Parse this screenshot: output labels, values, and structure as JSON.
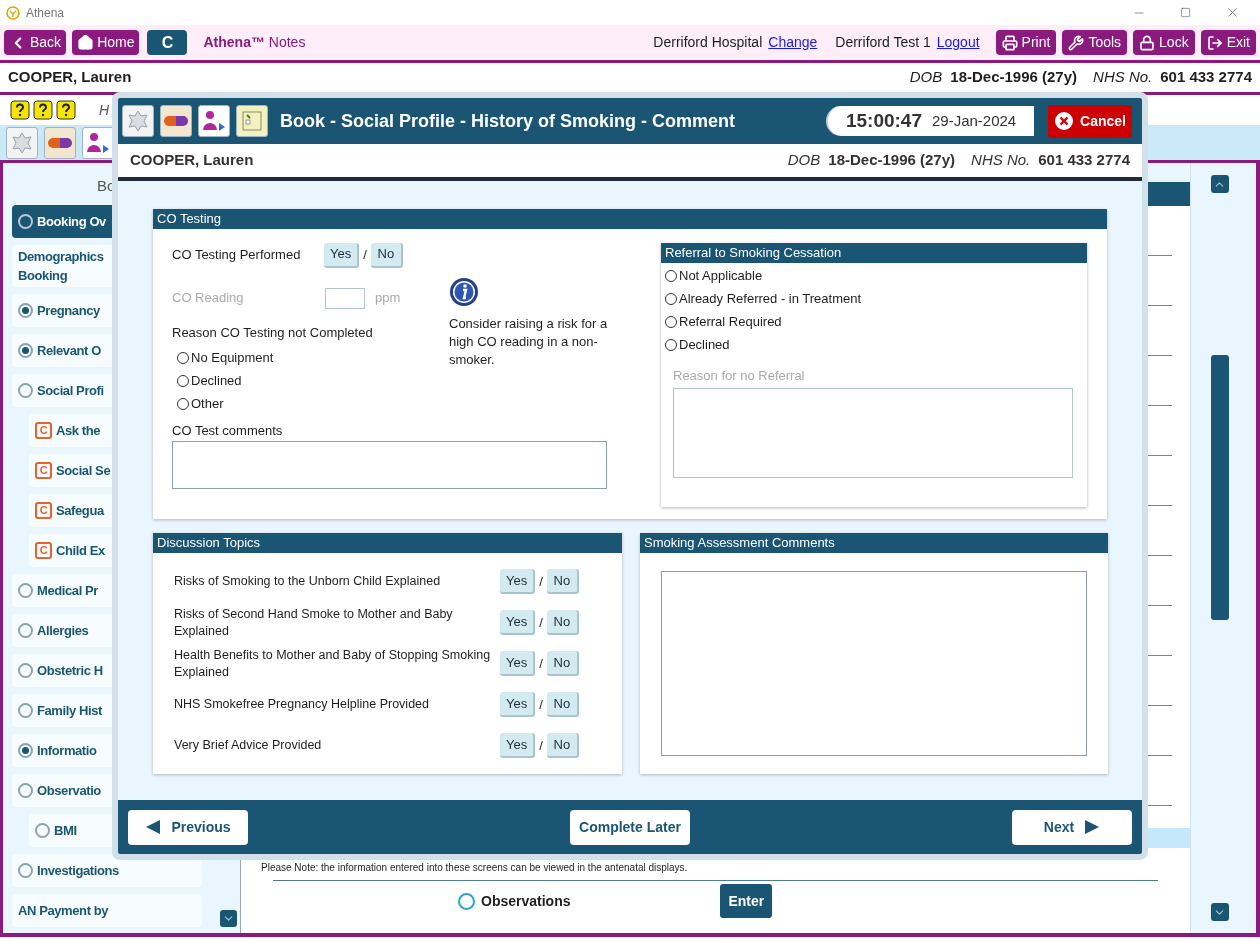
{
  "window": {
    "title": "Athena"
  },
  "toolbar": {
    "left_buttons": [
      {
        "label": "Back",
        "kind": "back"
      },
      {
        "label": "Home",
        "kind": "home"
      },
      {
        "label": "C",
        "kind": "plain"
      }
    ],
    "app_name": "**Athena™** Notes",
    "location": "Derriford Hospital",
    "location_link": "Change",
    "user": "Derriford Test 1",
    "user_link": "Logout",
    "right_buttons": [
      {
        "label": "Print",
        "kind": "print"
      },
      {
        "label": "Tools",
        "kind": "tools"
      },
      {
        "label": "Lock",
        "kind": "lock"
      },
      {
        "label": "Exit",
        "kind": "exit"
      }
    ]
  },
  "patient": {
    "name": "COOPER, Lauren",
    "dob_label": "DOB",
    "dob": "18-Dec-1996 (27y)",
    "nhs_label": "NHS No.",
    "nhs": "601 433 2774"
  },
  "subheader": {
    "text": "H"
  },
  "sidebar": {
    "heading": "Bo",
    "items": [
      {
        "label": "Booking Ov",
        "kind": "radio",
        "checked": false,
        "selected": true
      },
      {
        "lines": [
          "Demographics",
          "Booking"
        ],
        "kind": "plain",
        "selected": false
      },
      {
        "label": "Pregnancy",
        "kind": "radio",
        "checked": true,
        "selected": false
      },
      {
        "label": "Relevant O",
        "kind": "radio",
        "checked": true,
        "selected": false
      },
      {
        "label": "Social Profi",
        "kind": "radio",
        "checked": false,
        "selected": false,
        "children": [
          {
            "label": "Ask the",
            "kind": "category",
            "badge": "C",
            "selected": false
          },
          {
            "label": "Social Se",
            "kind": "category",
            "badge": "C",
            "selected": false
          },
          {
            "label": "Safegua",
            "kind": "category",
            "badge": "C",
            "selected": false
          },
          {
            "label": "Child Ex",
            "kind": "category",
            "badge": "C",
            "selected": false
          }
        ]
      },
      {
        "label": "Medical Pr",
        "kind": "radio",
        "checked": false,
        "selected": false
      },
      {
        "label": "Allergies",
        "kind": "radio",
        "checked": false,
        "selected": false
      },
      {
        "label": "Obstetric H",
        "kind": "radio",
        "checked": false,
        "selected": false
      },
      {
        "label": "Family Hist",
        "kind": "radio",
        "checked": false,
        "selected": false
      },
      {
        "label": "Informatio",
        "kind": "radio",
        "checked": true,
        "selected": false
      },
      {
        "label": "Observatio",
        "kind": "radio",
        "checked": false,
        "selected": false,
        "children": [
          {
            "label": "BMI",
            "kind": "radio",
            "checked": false,
            "selected": false
          }
        ]
      },
      {
        "label": "Investigations",
        "kind": "radio",
        "checked": false,
        "selected": false
      },
      {
        "label": "AN Payment by",
        "kind": "plain",
        "selected": false
      }
    ]
  },
  "main": {
    "note": "Please Note: the information entered into these screens can be viewed in the antenatal displays.",
    "option": {
      "label": "Observations",
      "checked": false
    },
    "enter_button": "Enter"
  },
  "dialog": {
    "title": "Book - Social Profile - History of Smoking - Comment",
    "time": "15:00:47",
    "date": "29-Jan-2024",
    "cancel": "Cancel",
    "patient": {
      "name": "COOPER, Lauren",
      "dob_label": "DOB",
      "dob": "18-Dec-1996 (27y)",
      "nhs_label": "NHS No.",
      "nhs": "601 433 2774"
    },
    "co_testing": {
      "title": "CO Testing",
      "performed": {
        "label": "CO Testing Performed",
        "separator": "/",
        "options": [
          {
            "label": "Yes",
            "selected": false
          },
          {
            "label": "No",
            "selected": false
          }
        ]
      },
      "reading": {
        "label": "CO Reading",
        "unit": "ppm",
        "disabled": true
      },
      "reason": {
        "label": "Reason CO Testing not Completed",
        "options": [
          {
            "label": "No Equipment",
            "checked": false
          },
          {
            "label": "Declined",
            "checked": false
          },
          {
            "label": "Other",
            "checked": false
          }
        ]
      },
      "comments_label": "CO Test comments",
      "info": "Consider raising a risk for a high CO reading in a non-smoker.",
      "referral": {
        "title": "Referral to Smoking Cessation",
        "options": [
          {
            "label": "Not Applicable",
            "checked": false
          },
          {
            "label": "Already Referred - in Treatment",
            "checked": false
          },
          {
            "label": "Referral Required",
            "checked": false
          },
          {
            "label": "Declined",
            "checked": false
          }
        ],
        "reason_label": "Reason for no Referral",
        "reason_disabled": true
      }
    },
    "discussion": {
      "title": "Discussion Topics",
      "rows": [
        {
          "label": "Risks of Smoking to the Unborn Child Explained",
          "separator": "/",
          "options": [
            {
              "label": "Yes",
              "selected": false
            },
            {
              "label": "No",
              "selected": false
            }
          ]
        },
        {
          "label": "Risks of Second Hand Smoke to Mother and Baby Explained",
          "separator": "/",
          "options": [
            {
              "label": "Yes",
              "selected": false
            },
            {
              "label": "No",
              "selected": false
            }
          ]
        },
        {
          "label": "Health Benefits to Mother and Baby of Stopping Smoking Explained",
          "separator": "/",
          "options": [
            {
              "label": "Yes",
              "selected": false
            },
            {
              "label": "No",
              "selected": false
            }
          ]
        },
        {
          "label": "NHS Smokefree Pregnancy Helpline Provided",
          "separator": "/",
          "options": [
            {
              "label": "Yes",
              "selected": false
            },
            {
              "label": "No",
              "selected": false
            }
          ]
        },
        {
          "label": "Very Brief Advice Provided",
          "separator": "/",
          "options": [
            {
              "label": "Yes",
              "selected": false
            },
            {
              "label": "No",
              "selected": false
            }
          ]
        }
      ]
    },
    "assessment": {
      "title": "Smoking Assessment Comments"
    },
    "footer": {
      "previous": "Previous",
      "complete_later": "Complete Later",
      "next": "Next"
    }
  }
}
